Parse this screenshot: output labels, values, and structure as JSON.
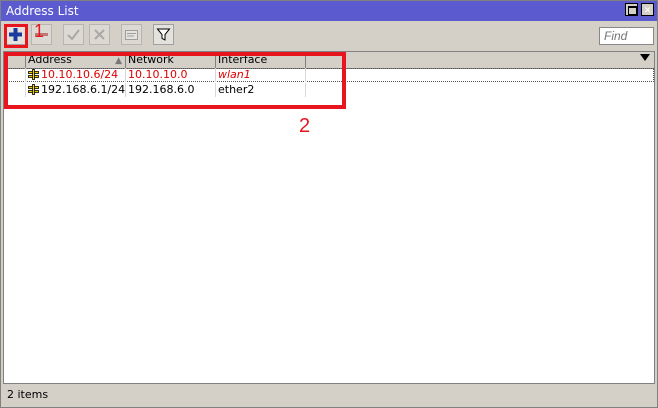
{
  "window": {
    "title": "Address List"
  },
  "toolbar": {
    "find_placeholder": "Find"
  },
  "table": {
    "columns": [
      "Address",
      "Network",
      "Interface"
    ],
    "rows": [
      {
        "address": "10.10.10.6/24",
        "network": "10.10.10.0",
        "interface": "wlan1",
        "state": "dynamic"
      },
      {
        "address": "192.168.6.1/24",
        "network": "192.168.6.0",
        "interface": "ether2",
        "state": "static"
      }
    ]
  },
  "status": {
    "items": "2 items"
  },
  "annotations": {
    "label1": "1",
    "label2": "2"
  },
  "colors": {
    "titlebar": "#5b5bcf",
    "annotation": "#e8141e",
    "dynamic_row": "#dd0000",
    "add_icon": "#1a3a9c"
  },
  "icons": {
    "add": "plus-icon",
    "remove": "minus-icon",
    "enable": "check-icon",
    "disable": "cross-icon",
    "comment": "comment-icon",
    "filter": "filter-icon",
    "row": "ip-address-icon"
  }
}
